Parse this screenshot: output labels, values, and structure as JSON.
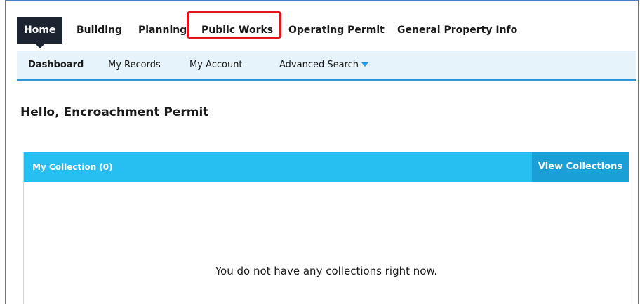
{
  "topnav": {
    "items": [
      {
        "label": "Home",
        "active": true
      },
      {
        "label": "Building"
      },
      {
        "label": "Planning"
      },
      {
        "label": "Public Works",
        "highlighted": true
      },
      {
        "label": "Operating Permit"
      },
      {
        "label": "General Property Info"
      }
    ]
  },
  "subnav": {
    "items": [
      {
        "label": "Dashboard",
        "active": true
      },
      {
        "label": "My Records"
      },
      {
        "label": "My Account"
      },
      {
        "label": "Advanced Search"
      }
    ]
  },
  "greeting": "Hello, Encroachment Permit",
  "collection_panel": {
    "title": "My Collection (0)",
    "button_label": "View Collections",
    "empty_message": "You do not have any collections right now."
  },
  "colors": {
    "active_tab_bg": "#1b2430",
    "highlight_border": "#e3141b",
    "subnav_bg": "#e7f3fb",
    "subnav_border": "#2f93d4",
    "panel_header": "#27bff1",
    "panel_button": "#1a9fd6"
  }
}
